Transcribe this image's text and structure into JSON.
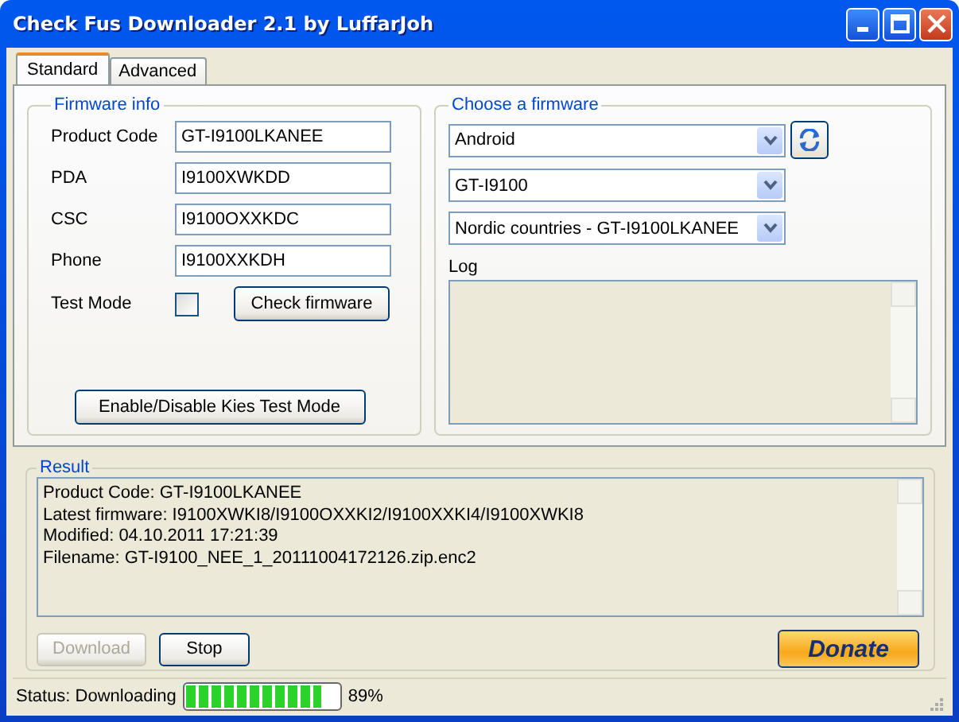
{
  "window": {
    "title": "Check Fus Downloader 2.1 by LuffarJoh"
  },
  "tabs": [
    {
      "label": "Standard",
      "selected": true
    },
    {
      "label": "Advanced",
      "selected": false
    }
  ],
  "firmware_info": {
    "title": "Firmware info",
    "fields": [
      {
        "label": "Product Code",
        "value": "GT-I9100LKANEE"
      },
      {
        "label": "PDA",
        "value": "I9100XWKDD"
      },
      {
        "label": "CSC",
        "value": "I9100OXXKDC"
      },
      {
        "label": "Phone",
        "value": "I9100XXKDH"
      }
    ],
    "test_mode": {
      "label": "Test Mode",
      "checked": false
    },
    "check_button": "Check firmware",
    "kies_button": "Enable/Disable Kies Test Mode"
  },
  "choose_firmware": {
    "title": "Choose a firmware",
    "dropdowns": [
      "Android",
      "GT-I9100",
      "Nordic countries - GT-I9100LKANEE"
    ],
    "log_label": "Log"
  },
  "result": {
    "title": "Result",
    "lines": [
      "Product Code: GT-I9100LKANEE",
      "Latest firmware: I9100XWKI8/I9100OXXKI2/I9100XXKI4/I9100XWKI8",
      "Modified: 04.10.2011 17:21:39",
      "Filename: GT-I9100_NEE_1_20111004172126.zip.enc2"
    ],
    "buttons": [
      {
        "label": "Download",
        "disabled": true
      },
      {
        "label": "Stop",
        "disabled": false
      }
    ],
    "donate": "Donate"
  },
  "status_bar": {
    "text": "Status: Downloading",
    "progress": {
      "level": 0.89
    },
    "percent": "89%"
  }
}
